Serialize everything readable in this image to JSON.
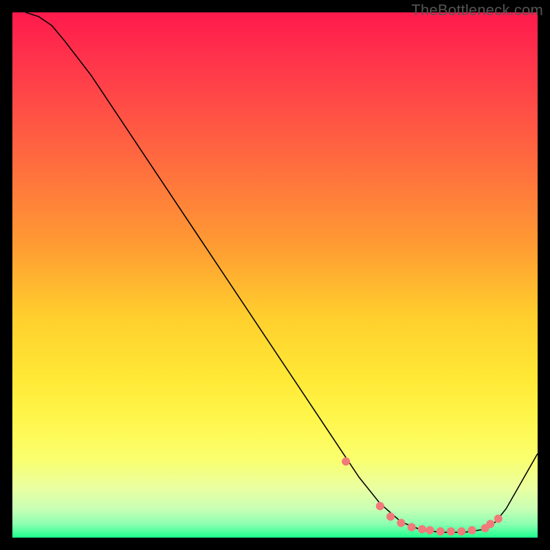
{
  "watermark": "TheBottleneck.com",
  "chart_data": {
    "type": "line",
    "title": "",
    "xlabel": "",
    "ylabel": "",
    "xlim": [
      0,
      100
    ],
    "ylim": [
      0,
      100
    ],
    "grid": false,
    "legend": false,
    "background": {
      "type": "vertical-gradient",
      "stops": [
        {
          "offset": 0.0,
          "color": "#ff1a4d"
        },
        {
          "offset": 0.12,
          "color": "#ff3c4a"
        },
        {
          "offset": 0.28,
          "color": "#ff6a3f"
        },
        {
          "offset": 0.44,
          "color": "#ff9a33"
        },
        {
          "offset": 0.58,
          "color": "#ffcf2d"
        },
        {
          "offset": 0.7,
          "color": "#ffe936"
        },
        {
          "offset": 0.78,
          "color": "#fff74e"
        },
        {
          "offset": 0.85,
          "color": "#faff6e"
        },
        {
          "offset": 0.905,
          "color": "#eaffa0"
        },
        {
          "offset": 0.945,
          "color": "#c9ffb5"
        },
        {
          "offset": 0.975,
          "color": "#8affb0"
        },
        {
          "offset": 1.0,
          "color": "#1cff8e"
        }
      ]
    },
    "series": [
      {
        "name": "curve",
        "stroke": "#000000",
        "stroke_width": 1.6,
        "x": [
          2.5,
          5.0,
          7.5,
          10,
          15,
          20,
          25,
          30,
          35,
          40,
          45,
          50,
          55,
          60,
          63,
          66,
          70,
          74,
          78,
          82,
          86,
          90,
          92,
          94,
          96,
          100
        ],
        "y": [
          100,
          99.2,
          97.5,
          94.5,
          88.0,
          80.5,
          73.0,
          65.5,
          58.0,
          50.5,
          43.0,
          35.5,
          28.0,
          20.5,
          16.0,
          11.5,
          6.5,
          3.0,
          1.4,
          1.0,
          1.0,
          1.6,
          3.0,
          5.5,
          9.0,
          16.0
        ]
      }
    ],
    "markers": {
      "name": "highlight-points",
      "color": "#f17a7a",
      "radius": 6,
      "x": [
        63.5,
        70.0,
        72.0,
        74.0,
        76.0,
        78.0,
        79.5,
        81.5,
        83.5,
        85.5,
        87.5,
        90.0,
        91.0,
        92.5
      ],
      "y": [
        14.5,
        6.0,
        4.0,
        2.8,
        2.0,
        1.6,
        1.4,
        1.2,
        1.2,
        1.2,
        1.4,
        1.8,
        2.6,
        3.6
      ]
    }
  }
}
